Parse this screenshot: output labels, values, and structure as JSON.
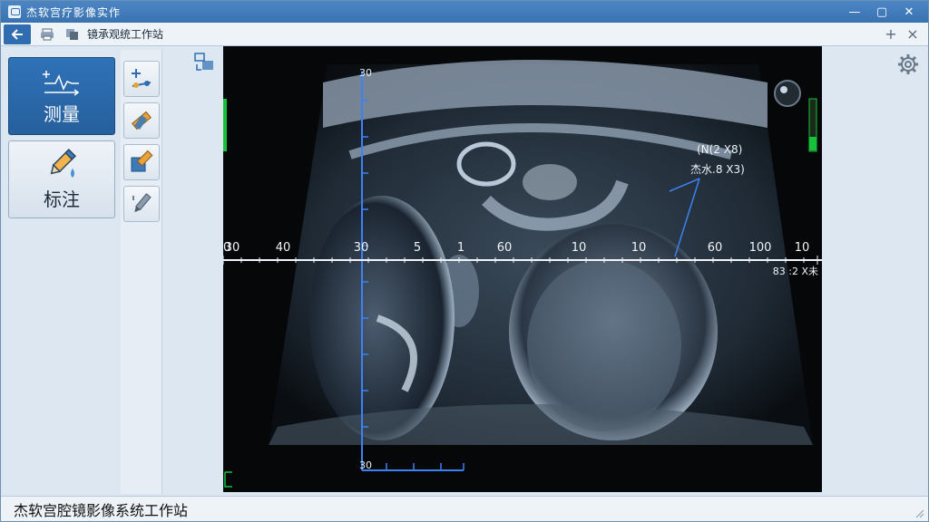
{
  "window": {
    "title": "杰软宫疗影像实作",
    "controls": {
      "minimize": "—",
      "maximize": "▢",
      "close": "✕"
    }
  },
  "toolbar": {
    "title": "镜承观统工作站",
    "add_tab": "+",
    "close_tab": "×"
  },
  "left_panel": {
    "measure_label": "测量",
    "annotate_label": "标注"
  },
  "viewer": {
    "top_tick": "30",
    "bottom_tick": "30",
    "scale_left": "20",
    "ruler_labels": [
      "30",
      "40",
      "30",
      "5",
      "1",
      "60",
      "10",
      "10",
      "60",
      "100",
      "10"
    ],
    "annotation_line1": "(N(2 X8)",
    "annotation_line2": "杰水.8 X3)",
    "scale_readout": "83 :2 X未"
  },
  "status": {
    "text": "杰软宫腔镜影像系统工作站"
  },
  "colors": {
    "titlebar": "#3f7bbd",
    "accent": "#2f72b8",
    "measure_line": "#3b82f6",
    "green_marker": "#16c23a"
  }
}
